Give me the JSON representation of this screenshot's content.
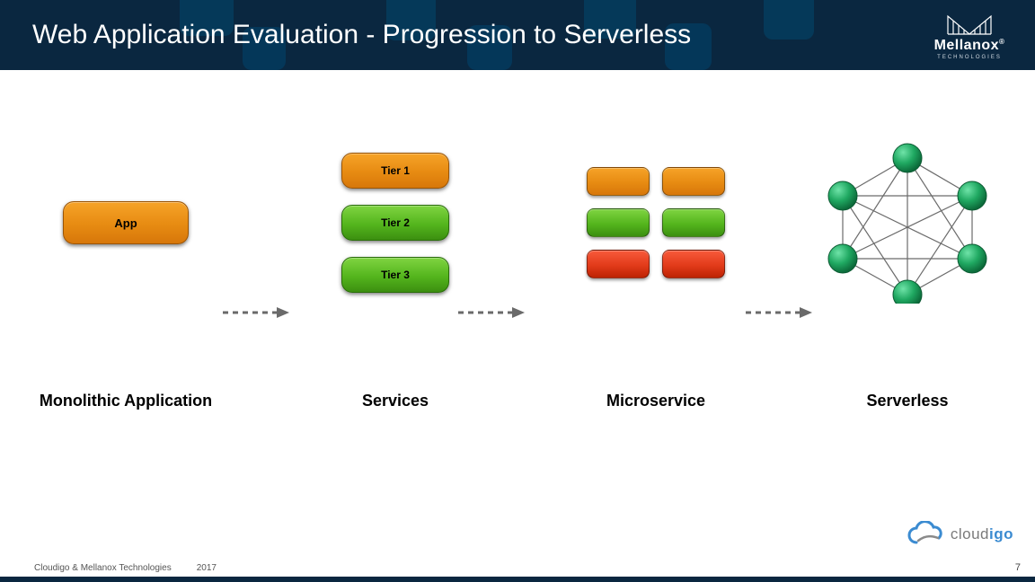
{
  "header": {
    "title": "Web Application Evaluation - Progression to Serverless",
    "brand": "Mellanox",
    "brand_sub": "TECHNOLOGIES"
  },
  "columns": {
    "monolithic": {
      "label": "Monolithic Application",
      "box": "App"
    },
    "services": {
      "label": "Services",
      "tiers": [
        "Tier 1",
        "Tier 2",
        "Tier 3"
      ]
    },
    "micro": {
      "label": "Microservice"
    },
    "serverless": {
      "label": "Serverless"
    }
  },
  "footer": {
    "copyright": "Cloudigo & Mellanox Technologies",
    "year": "2017",
    "page": "7",
    "cloudigo_prefix": "cloud",
    "cloudigo_suffix": "igo"
  },
  "colors": {
    "header_bg": "#0a2740",
    "orange": "#e78b12",
    "green": "#54b51d",
    "red": "#e23b1a",
    "node_green": "#1fa861"
  }
}
